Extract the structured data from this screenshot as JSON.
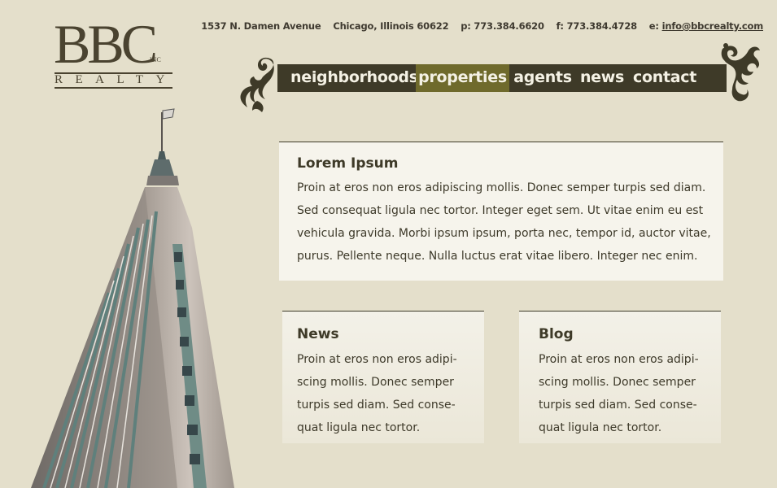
{
  "logo": {
    "main": "BBC",
    "inc": "INC",
    "sub": "REALTY"
  },
  "contact": {
    "address": "1537 N. Damen Avenue",
    "city": "Chicago, Illinois 60622",
    "phone": "p: 773.384.6620",
    "fax": "f: 773.384.4728",
    "email_prefix": "e:",
    "email": "info@bbcrealty.com"
  },
  "nav": {
    "items": [
      {
        "label": "neighborhoods",
        "active": false
      },
      {
        "label": "properties",
        "active": true
      },
      {
        "label": "agents",
        "active": false
      },
      {
        "label": "news",
        "active": false
      },
      {
        "label": "contact",
        "active": false
      }
    ]
  },
  "main": {
    "title": "Lorem Ipsum",
    "body": "Proin at eros non eros adipiscing mollis. Donec semper turpis sed diam. Sed consequat ligula nec tortor. Integer eget sem. Ut vitae enim eu est vehicula gravida. Morbi ipsum ipsum, porta nec, tempor id, auctor vitae, purus. Pellente neque. Nulla luctus erat vitae libero. Integer nec enim."
  },
  "news": {
    "title": "News",
    "body": "Proin at eros non eros adipi-scing mollis. Donec semper turpis sed diam. Sed conse-quat ligula nec tortor."
  },
  "blog": {
    "title": "Blog",
    "body": "Proin at eros non eros adipi-scing mollis. Donec semper turpis sed diam. Sed conse-quat ligula nec tortor."
  },
  "colors": {
    "background": "#e4dfcb",
    "nav_bar": "#3e3a28",
    "nav_active": "#6f6a2c",
    "box": "#f6f4ec",
    "text_dark": "#3e3a28"
  },
  "icons": [
    "left-flourish-icon",
    "right-flourish-icon",
    "building-image"
  ]
}
